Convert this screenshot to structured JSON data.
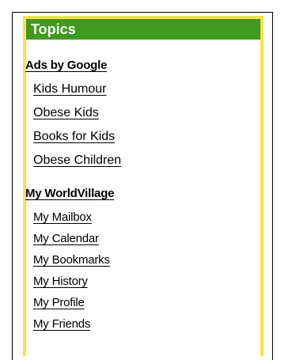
{
  "panel": {
    "title": "Topics"
  },
  "ads": {
    "title": "Ads by Google",
    "links": [
      "Kids Humour",
      "Obese Kids",
      "Books for Kids",
      "Obese Children"
    ]
  },
  "worldvillage": {
    "title": "My WorldVillage",
    "links": [
      "My Mailbox",
      "My Calendar",
      "My Bookmarks",
      "My History",
      "My Profile",
      "My Friends"
    ]
  }
}
